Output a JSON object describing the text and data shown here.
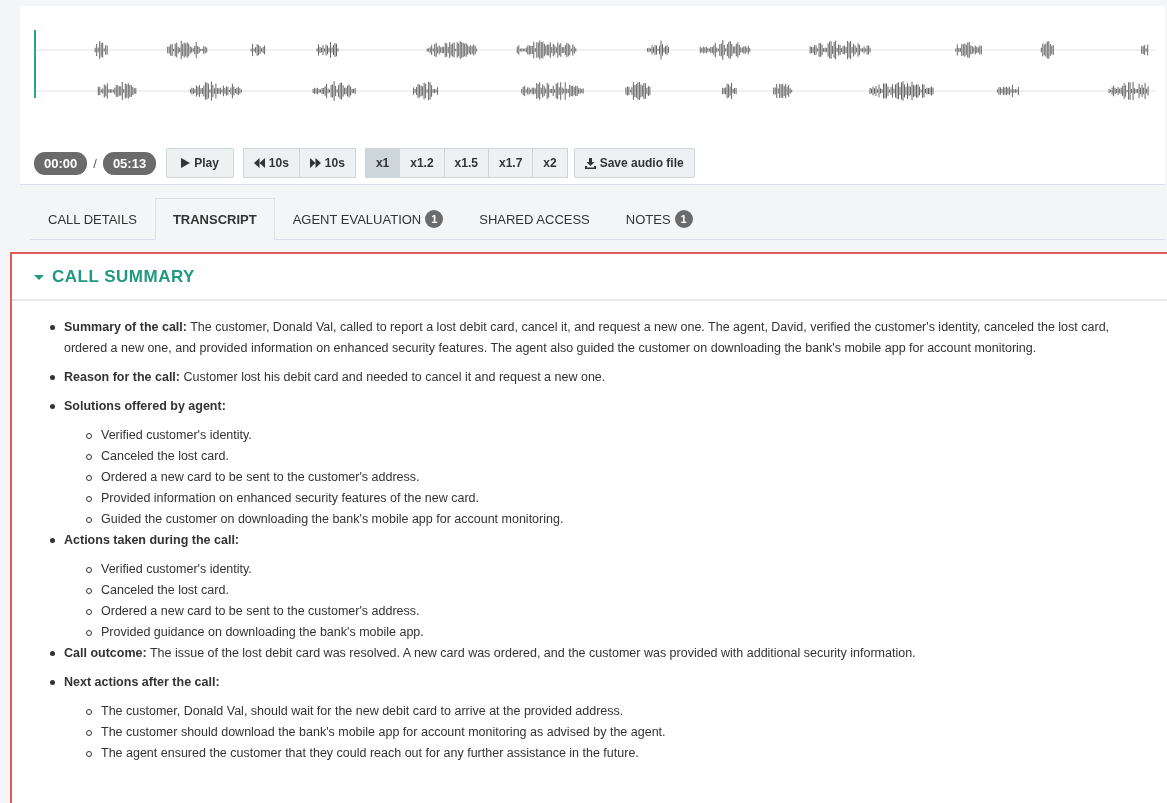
{
  "player": {
    "current_time": "00:00",
    "separator": "/",
    "duration": "05:13",
    "play": "Play",
    "back": "10s",
    "forward": "10s",
    "speeds": [
      {
        "label": "x1",
        "selected": true
      },
      {
        "label": "x1.2",
        "selected": false
      },
      {
        "label": "x1.5",
        "selected": false
      },
      {
        "label": "x1.7",
        "selected": false
      },
      {
        "label": "x2",
        "selected": false
      }
    ],
    "save": "Save audio file"
  },
  "tabs": [
    {
      "label": "CALL DETAILS",
      "selected": false
    },
    {
      "label": "TRANSCRIPT",
      "selected": true
    },
    {
      "label": "AGENT EVALUATION",
      "selected": false,
      "badge": "1"
    },
    {
      "label": "SHARED ACCESS",
      "selected": false
    },
    {
      "label": "NOTES",
      "selected": false,
      "badge": "1"
    }
  ],
  "summary": {
    "title": "CALL SUMMARY",
    "expanded": true,
    "items": [
      {
        "kind": "sentence",
        "text": "**Summary of the call:** The customer, Donald Val, called to report a lost debit card, cancel it, and request a new one. The agent, David, verified the customer's identity, canceled the lost card, ordered a new one, and provided information on enhanced security features. The agent also guided the customer on downloading the bank's mobile app for account monitoring."
      },
      {
        "kind": "sentence",
        "text": "**Reason for the call:** Customer lost his debit card and needed to cancel it and request a new one."
      },
      {
        "kind": "list",
        "label": "Solutions offered by agent:",
        "children": [
          "Verified customer's identity.",
          "Canceled the lost card.",
          "Ordered a new card to be sent to the customer's address.",
          "Provided information on enhanced security features of the new card.",
          "Guided the customer on downloading the bank's mobile app for account monitoring."
        ]
      },
      {
        "kind": "list",
        "label": "Actions taken during the call:",
        "children": [
          "Verified customer's identity.",
          "Canceled the lost card.",
          "Ordered a new card to be sent to the customer's address.",
          "Provided guidance on downloading the bank's mobile app."
        ]
      },
      {
        "kind": "sentence",
        "text": "**Call outcome:** The issue of the lost debit card was resolved. A new card was ordered, and the customer was provided with additional security information."
      },
      {
        "kind": "list",
        "label": "Next actions after the call:",
        "children": [
          "The customer, Donald Val, should wait for the new debit card to arrive at the provided address.",
          "The customer should download the bank's mobile app for account monitoring as advised by the agent.",
          "The agent ensured the customer that they could reach out for any further assistance in the future."
        ]
      }
    ]
  }
}
